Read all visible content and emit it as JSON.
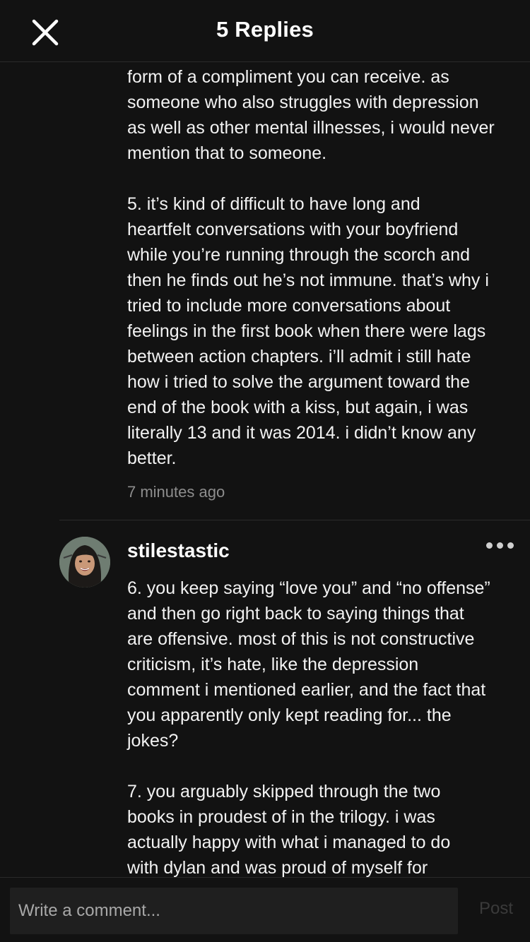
{
  "header": {
    "title": "5 Replies"
  },
  "replies": [
    {
      "body": "form of a compliment you can receive. as\nsomeone who also struggles with depression\nas well as other mental illnesses, i would never\nmention that to someone.\n\n5. it’s kind of difficult to have long and\nheartfelt conversations with your boyfriend\nwhile you’re running through the scorch and\nthen he finds out he’s not immune. that’s why i\ntried to include more conversations about\nfeelings in the first book when there were lags\nbetween action chapters. i’ll admit i still hate\nhow i tried to solve the argument toward the\nend of the book with a kiss, but again, i was\nliterally 13 and it was 2014. i didn’t know any\nbetter.",
      "time": "7 minutes ago"
    },
    {
      "username": "stilestastic",
      "body": "6. you keep saying “love you” and “no offense”\nand then go right back to saying things that\nare offensive. most of this is not constructive\ncriticism, it’s hate, like the depression\ncomment i mentioned earlier, and the fact that\nyou apparently only kept reading for... the\njokes?\n\n7. you arguably skipped through the two\nbooks in proudest of in the trilogy. i was\nactually happy with what i managed to do\nwith dylan and was proud of myself for"
    }
  ],
  "footer": {
    "placeholder": "Write a comment...",
    "post_label": "Post"
  },
  "colors": {
    "background": "#121212",
    "input_background": "#1f1f1f",
    "timestamp": "#8d8d8d",
    "post_disabled": "#3a3a3a"
  },
  "icons": {
    "close": "close-icon",
    "more": "more-options-icon",
    "avatar": "user-avatar"
  }
}
